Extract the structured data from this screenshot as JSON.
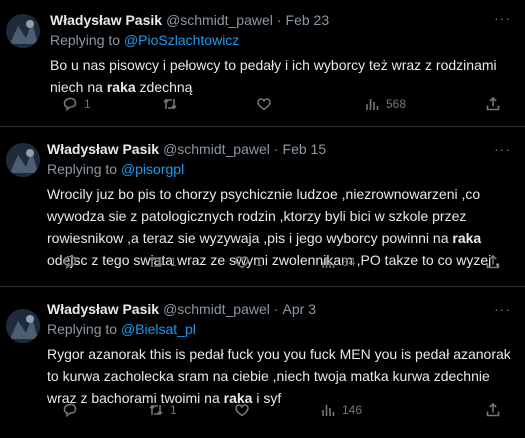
{
  "tweets": [
    {
      "name": "Władysław Pasik",
      "handle": "@schmidt_pawel",
      "separator": "·",
      "date": "Feb 23",
      "more": "···",
      "replying_prefix": "Replying to",
      "replying_to": "@PioSzlachtowicz",
      "lines": [
        {
          "pre": "Bo u nas pisowcy i pełowcy to pedały i ich wyborcy też wraz z rodzinami",
          "bold": "",
          "post": ""
        },
        {
          "pre": "niech na ",
          "bold": "raka",
          "post": " zdechną"
        }
      ],
      "replies": "1",
      "retweets": "",
      "likes": "",
      "views": "568"
    },
    {
      "name": "Władysław Pasik",
      "handle": "@schmidt_pawel",
      "separator": "·",
      "date": "Feb 15",
      "more": "···",
      "replying_prefix": "Replying to",
      "replying_to": "@pisorgpl",
      "lines": [
        {
          "pre": "Wrocily juz bo pis to chorzy psychicznie ludzoe ,niezrownowarzeni ,co",
          "bold": "",
          "post": ""
        },
        {
          "pre": "wywodza sie z patologicznych rodzin ,ktorzy byli bici w szkole przez",
          "bold": "",
          "post": ""
        },
        {
          "pre": "rowiesnikow ,a teraz sie wyzywaja ,pis i jego wyborcy powinni na ",
          "bold": "raka",
          "post": ""
        },
        {
          "pre": "odejsc z tego swiata wraz ze swymi zwolennikam ,PO takze to co wyzej ,",
          "bold": "",
          "post": ""
        }
      ],
      "replies": "",
      "retweets": "1",
      "likes": "1",
      "views": "34"
    },
    {
      "name": "Władysław Pasik",
      "handle": "@schmidt_pawel",
      "separator": "·",
      "date": "Apr 3",
      "more": "···",
      "replying_prefix": "Replying to",
      "replying_to": "@Bielsat_pl",
      "lines": [
        {
          "pre": "Rygor azanorak this is pedał fuck you you fuck MEN you is pedał  azanorak",
          "bold": "",
          "post": ""
        },
        {
          "pre": "to kurwa zacholecka sram na ciebie ,niech twoja matka kurwa zdechnie",
          "bold": "",
          "post": ""
        },
        {
          "pre": "wraz z bachorami twoimi na ",
          "bold": "raka",
          "post": " i syf"
        }
      ],
      "replies": "",
      "retweets": "1",
      "likes": "",
      "views": "146"
    }
  ],
  "colors": {
    "background": "#000000",
    "text": "#e7e9ea",
    "muted": "#71767b",
    "mention": "#1d9bf0",
    "divider": "#2f3336"
  },
  "icons": [
    "reply-icon",
    "retweet-icon",
    "like-icon",
    "views-icon",
    "share-icon",
    "more-icon"
  ]
}
